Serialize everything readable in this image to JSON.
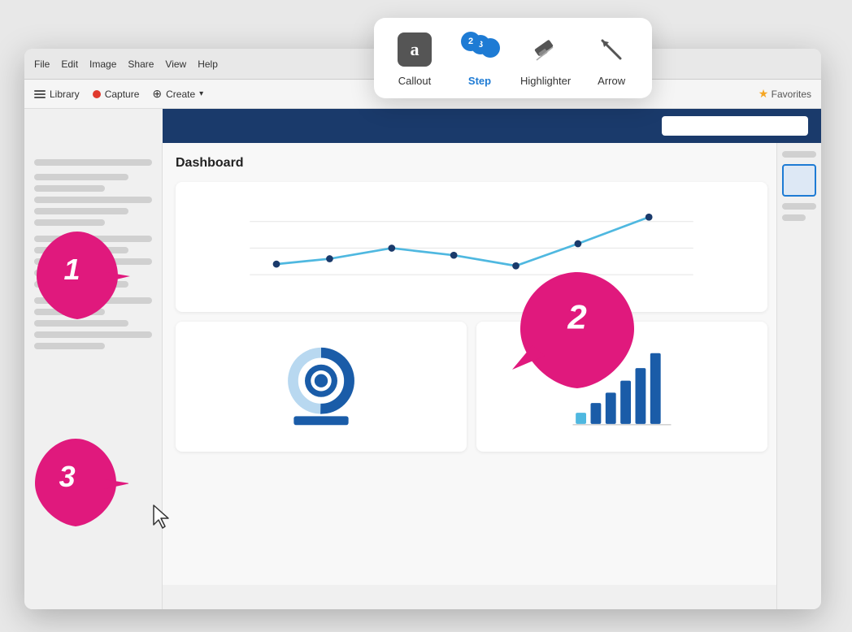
{
  "toolbar_popup": {
    "tools": [
      {
        "id": "callout",
        "label": "Callout",
        "active": false,
        "icon": "callout-icon"
      },
      {
        "id": "step",
        "label": "Step",
        "active": true,
        "icon": "step-icon"
      },
      {
        "id": "highlighter",
        "label": "Highlighter",
        "active": false,
        "icon": "highlighter-icon"
      },
      {
        "id": "arrow",
        "label": "Arrow",
        "active": false,
        "icon": "arrow-icon"
      }
    ]
  },
  "title_bar": {
    "menus": [
      "File",
      "Edit",
      "Image",
      "Share",
      "View",
      "Help"
    ],
    "library": "Library",
    "capture": "Capture",
    "create": "Create",
    "favorites": "Favorites"
  },
  "dashboard": {
    "title": "Dashboard"
  },
  "step_labels": {
    "one": "1",
    "two": "2",
    "three": "3"
  }
}
